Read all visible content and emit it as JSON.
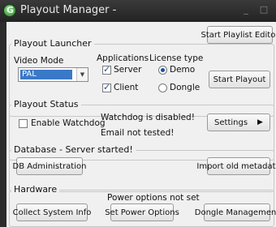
{
  "window": {
    "title": "Playout Manager -",
    "minimize_glyph": "_",
    "maximize_glyph": "□"
  },
  "toolbar": {
    "start_playlist_editor": "Start Playlist Editor"
  },
  "launcher": {
    "legend": "Playout Launcher",
    "video_mode_label": "Video Mode",
    "video_mode_value": "PAL",
    "applications_label": "Applications",
    "server_label": "Server",
    "server_checked": true,
    "client_label": "Client",
    "client_checked": true,
    "license_label": "License type",
    "license_options": [
      "Demo",
      "Dongle"
    ],
    "license_selected": "Demo",
    "start_playout": "Start Playout"
  },
  "status": {
    "legend": "Playout Status",
    "enable_watchdog_label": "Enable Watchdog",
    "enable_watchdog_checked": false,
    "watchdog_message": "Watchdog is disabled!",
    "email_message": "Email not tested!",
    "settings_label": "Settings"
  },
  "database": {
    "legend": "Database - Server started!",
    "db_admin": "DB Administration",
    "import_metadata": "Import old metadata"
  },
  "hardware": {
    "legend": "Hardware",
    "power_note": "Power options not set",
    "collect_info": "Collect System Info",
    "set_power": "Set Power Options",
    "dongle_mgmt": "Dongle Management"
  }
}
